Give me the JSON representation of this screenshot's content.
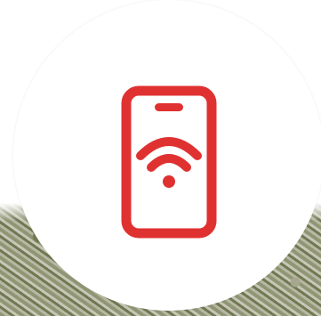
{
  "badge": {
    "icon": "phone-wifi-icon",
    "accent_color": "#e03131",
    "background_color": "#ffffff"
  }
}
